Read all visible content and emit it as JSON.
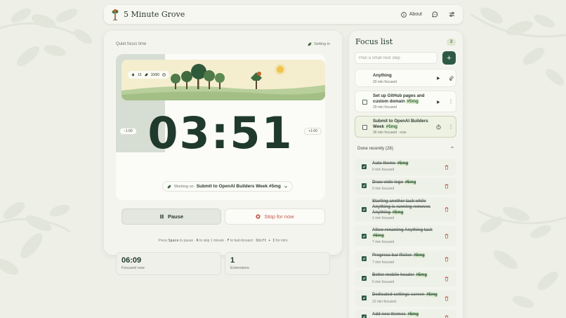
{
  "app": {
    "title": "5 Minute Grove",
    "about_label": "About"
  },
  "timer": {
    "quiet_label": "Quiet focus time",
    "setting_label": "Setting in",
    "chip_trees": "15",
    "chip_progress": "10/60",
    "minus_label": "−1:00",
    "plus_label": "+1:00",
    "time": "03:51",
    "working_on_label": "Working on",
    "working_on_task": "Submit to OpenAI Builders Week #5mg",
    "pause_label": "Pause",
    "stop_label": "Stop for now",
    "hint": {
      "p1": "Press ",
      "k1": "Space",
      "p2": " to pause · ",
      "k2": "R",
      "p3": " to skip 1 minute · ",
      "k3": "F",
      "p4": " to fast-forward · ",
      "k4": "Shift + I",
      "p5": " for intro"
    },
    "stats": [
      {
        "value": "06:09",
        "label": "Focused now"
      },
      {
        "value": "1",
        "label": "Extensions"
      }
    ]
  },
  "focus_list": {
    "title": "Focus list",
    "count": "3",
    "input_placeholder": "Plan a small next step",
    "add_label": "+",
    "tasks": [
      {
        "title": "Anything",
        "tag": "",
        "meta": "20 min focused"
      },
      {
        "title": "Set up GitHub pages and custom domain",
        "tag": "#5mg",
        "meta": "29 min focused"
      },
      {
        "title": "Submit to OpenAI Builders Week",
        "tag": "#5mg",
        "meta": "36 min focused · now"
      }
    ],
    "done_header": "Done recently (28)",
    "done": [
      {
        "title": "Auto theme",
        "tag": "#5mg",
        "meta": "0 min focused"
      },
      {
        "title": "Draw wide logo",
        "tag": "#5mg",
        "meta": "0 min focused"
      },
      {
        "title": "Starting another task while Anything is running removes Anything",
        "tag": "#5mg",
        "meta": "1 min focused"
      },
      {
        "title": "Allow renaming Anything task",
        "tag": "#5mg",
        "meta": "7 min focused"
      },
      {
        "title": "Progress bar flicker",
        "tag": "#5mg",
        "meta": "7 min focused"
      },
      {
        "title": "Better mobile header",
        "tag": "#5mg",
        "meta": "5 min focused"
      },
      {
        "title": "Dedicated settings screen",
        "tag": "#5mg",
        "meta": "12 min focused"
      },
      {
        "title": "Add new themes",
        "tag": "#5mg",
        "meta": ""
      }
    ]
  },
  "colors": {
    "accent": "#2e5a44",
    "background": "#eef0e8",
    "stop": "#c2584b",
    "tag_bg": "#dfeccf"
  }
}
